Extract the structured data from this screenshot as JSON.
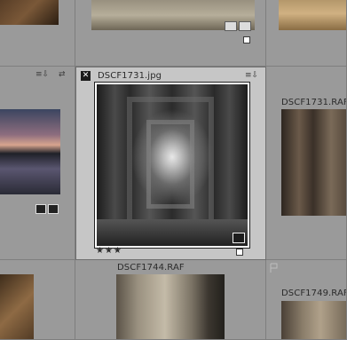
{
  "grid": {
    "selected": {
      "filename": "DSCF1731.jpg",
      "rating": "★★★",
      "flag_symbol": "✕"
    },
    "right_cell": {
      "filename": "DSCF1731.RAF"
    },
    "bottom_cell": {
      "filename": "DSCF1744.RAF"
    },
    "bottom_right_cell": {
      "filename": "DSCF1749.RAF"
    },
    "icons": {
      "rotate_left": "≡⇩",
      "rotate_right": "⇄",
      "badge_edit": "⬚",
      "badge_crop": "⌗"
    }
  },
  "colors": {
    "grid_bg": "#9a9a9a",
    "selected_bg": "#c6c6c6"
  }
}
